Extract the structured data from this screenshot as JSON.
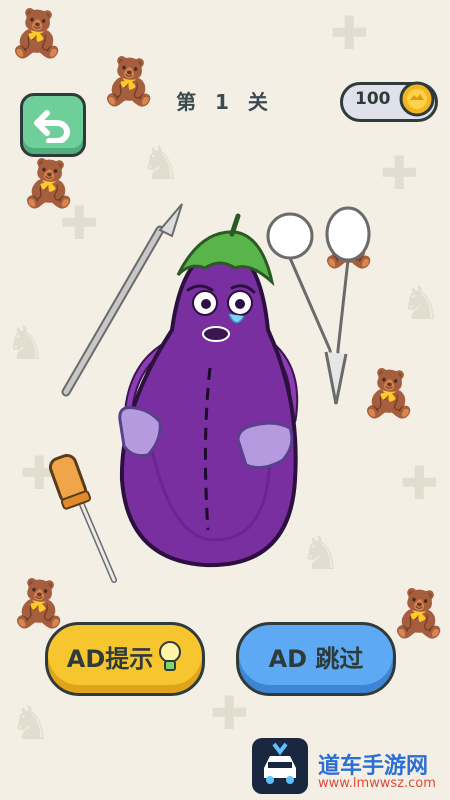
{
  "header": {
    "level_title": "第 1 关",
    "coins": "100"
  },
  "buttons": {
    "hint_label": "AD提示",
    "skip_label": "AD 跳过"
  },
  "watermark": {
    "title": "道车手游网",
    "url": "www.lmwwsz.com"
  },
  "colors": {
    "background": "#f3efe4",
    "back_button": "#6fcf9b",
    "hint_button": "#f7c62f",
    "skip_button": "#5ea9f3",
    "eggplant": "#7a2fa0",
    "stem": "#59b44a"
  }
}
